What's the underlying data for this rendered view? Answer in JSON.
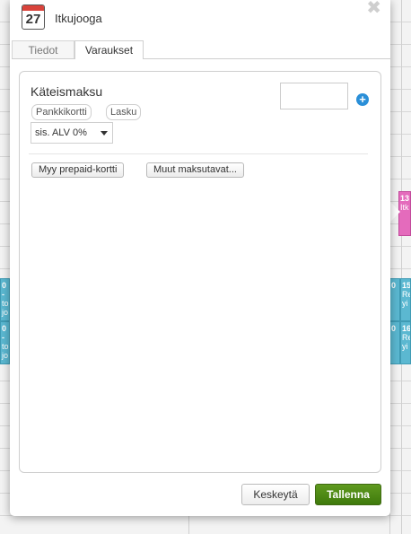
{
  "window": {
    "title": "Itkujooga",
    "calendar_day": "27",
    "close_symbol": "✖"
  },
  "tabs": [
    {
      "label": "Tiedot",
      "active": false
    },
    {
      "label": "Varaukset",
      "active": true
    }
  ],
  "payment": {
    "method_title": "Käteismaksu",
    "amount_value": "",
    "alternative_methods": [
      "Pankkikortti",
      "Lasku"
    ],
    "vat_selected": "sis. ALV 0%",
    "buttons": {
      "prepaid": "Myy prepaid-kortti",
      "other_methods": "Muut maksutavat..."
    }
  },
  "footer": {
    "cancel_label": "Keskeytä",
    "save_label": "Tallenna"
  },
  "background_events": [
    {
      "time": "13",
      "title": "Itk"
    },
    {
      "time": "0 -",
      "title": "to jo"
    },
    {
      "time": "15",
      "title": "Re yi"
    },
    {
      "time": "0 -",
      "title": "to jo"
    },
    {
      "time": "16",
      "title": "Re yi"
    }
  ],
  "colors": {
    "save_green": "#4a8a14",
    "plus_blue": "#2a8fd8",
    "event_blue": "#5bb8d1",
    "event_pink": "#e46bbc",
    "calendar_red": "#d9433b"
  }
}
